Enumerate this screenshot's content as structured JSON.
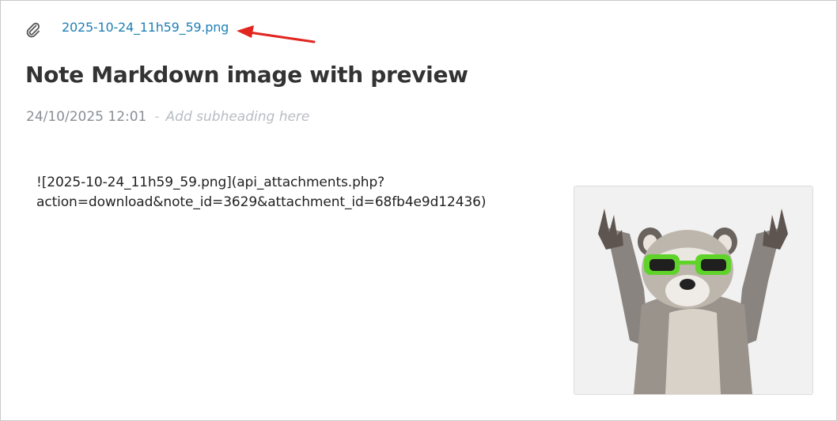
{
  "attachment": {
    "icon": "paperclip-icon",
    "filename": "2025-10-24_11h59_59.png"
  },
  "annotation": {
    "icon": "red-arrow-icon",
    "color": "#e0261f"
  },
  "note": {
    "title": "Note Markdown image with preview",
    "date": "24/10/2025 12:01",
    "separator": "-",
    "subheading_placeholder": "Add subheading here",
    "markdown_line1": "![2025-10-24_11h59_59.png](api_attachments.php?",
    "markdown_line2": "action=download&note_id=3629&attachment_id=68fb4e9d12436)"
  },
  "preview": {
    "subject": "raccoon-with-green-sunglasses-image"
  },
  "colors": {
    "link": "#1f7fb5",
    "title": "#333333",
    "muted": "#8a8f95"
  }
}
